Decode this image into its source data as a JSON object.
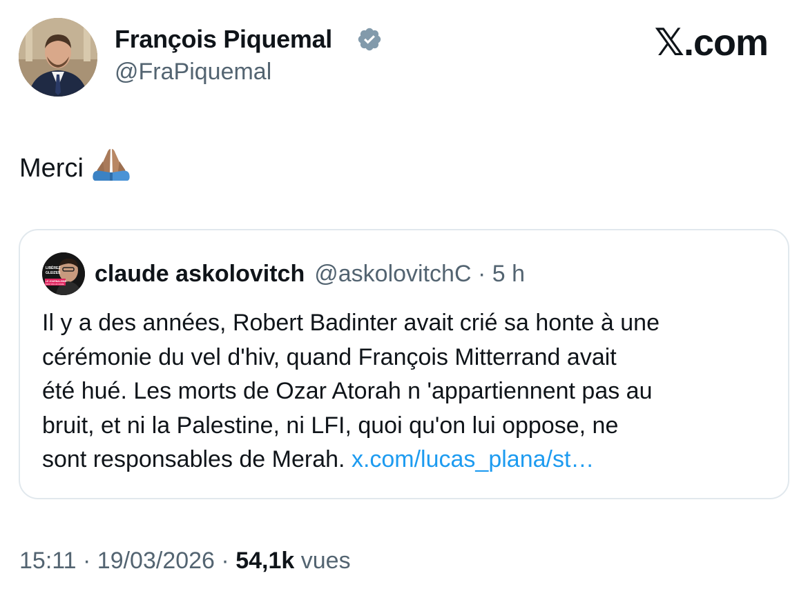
{
  "brand": {
    "text": "𝕏.com"
  },
  "author": {
    "name": "François Piquemal",
    "handle": "@FraPiquemal",
    "verified_color": "#829aab"
  },
  "tweet": {
    "text": "Merci",
    "emoji": "folded-hands-icon"
  },
  "quote": {
    "name": "claude askolovitch",
    "handle": "@askolovitchC",
    "separator": "·",
    "time": "5 h",
    "avatar_text": [
      "LIBÉREZ",
      "GLEIZES",
      "LE JOURNALISME",
      "N'EST PAS UN CRIME"
    ],
    "body_lines": [
      "Il y a des années, Robert Badinter avait crié sa honte à une",
      "cérémonie du vel d'hiv, quand François Mitterrand avait",
      "été hué. Les morts de Ozar Atorah n 'appartiennent pas au",
      "bruit, et ni la Palestine, ni LFI, quoi qu'on lui oppose, ne",
      "sont responsables de Merah."
    ],
    "link": "x.com/lucas_plana/st…",
    "link_color": "#1d9bf0"
  },
  "footer": {
    "time": "15:11",
    "sep1": "·",
    "date": "19/03/2026",
    "sep2": "·",
    "views_count": "54,1k",
    "views_label": "vues"
  }
}
